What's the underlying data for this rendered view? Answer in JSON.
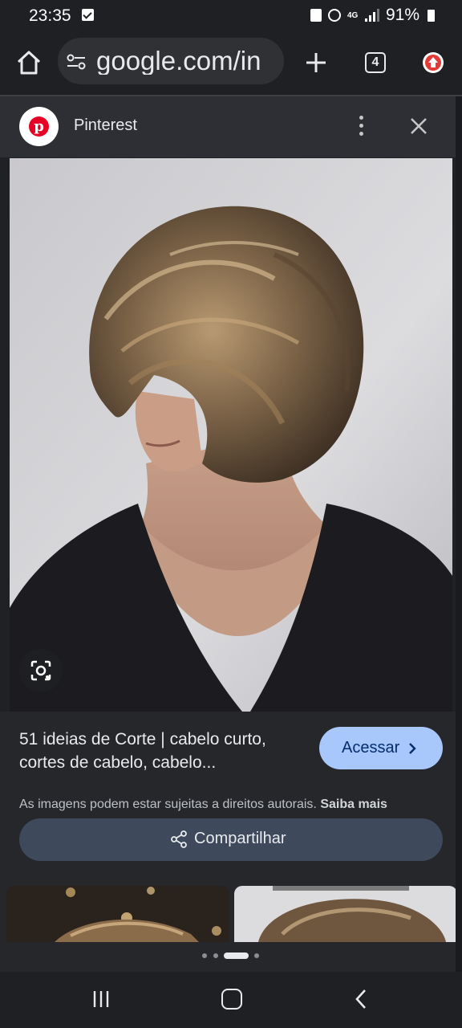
{
  "status_bar": {
    "time": "23:35",
    "battery": "91%",
    "network": "4G"
  },
  "browser": {
    "url": "google.com/in",
    "tab_count": "4",
    "icons": [
      "home-icon",
      "page-info-icon",
      "new-tab-icon",
      "tab-switcher-icon",
      "update-icon"
    ]
  },
  "source": {
    "name": "Pinterest",
    "logo_letter": "p"
  },
  "result": {
    "title": "51 ideias de Corte | cabelo curto, cortes de cabelo, cabelo...",
    "visit_label": "Acessar",
    "copyright_notice": "As imagens podem estar sujeitas a direitos autorais.",
    "learn_more": "Saiba mais",
    "share_label": "Compartilhar"
  },
  "colors": {
    "accent": "#a8c7fa",
    "pinterest_red": "#e60023",
    "share_button": "#3e4a5c",
    "background": "#1f2023"
  },
  "carousel": {
    "dots": 4,
    "active_dot": 3
  }
}
